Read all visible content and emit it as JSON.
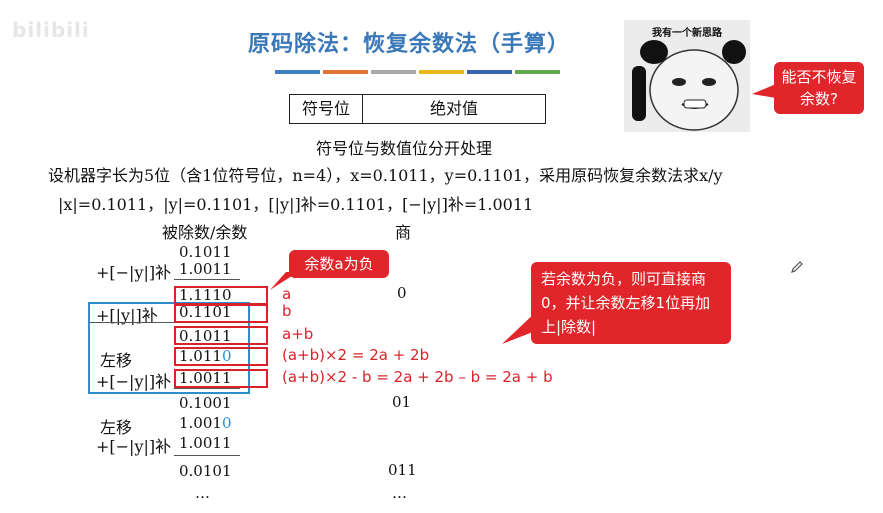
{
  "watermark": "bilibili",
  "title": "原码除法：恢复余数法（手算）",
  "color_bars": [
    "#3f7fc2",
    "#e0743a",
    "#a8a8a8",
    "#e7b81e",
    "#3a64a8",
    "#63a84a"
  ],
  "format_table": {
    "sign": "符号位",
    "magnitude": "绝对值"
  },
  "subtitle": "符号位与数值位分开处理",
  "problem_line": "设机器字长为5位（含1位符号位，n=4），x=0.1011，y=0.1101，采用原码恢复余数法求x/y",
  "values_line": "|x|=0.1011，|y|=0.1101，[|y|]补=0.1101，[−|y|]补=1.0011",
  "headers": {
    "dividend": "被除数/余数",
    "quotient": "商"
  },
  "rows": {
    "r1": "0.1011",
    "r2": "1.0011",
    "r3": "1.1110",
    "r4": "0.1101",
    "r5": "0.1011",
    "r6_main": "1.011",
    "r6_tail": "0",
    "r7": "1.0011",
    "r8": "0.1001",
    "r9_main": "1.001",
    "r9_tail": "0",
    "r10": "1.0011",
    "r11": "0.0101",
    "r12": "…"
  },
  "labels": {
    "add_neg_y": "+[−|y|]补",
    "add_y": "+[|y|]补",
    "shift_left": "左移"
  },
  "quotients": {
    "q1": "0",
    "q2": "01",
    "q3": "011",
    "q4": "…"
  },
  "annotations": {
    "a": "a",
    "b": "b",
    "a_plus_b": "a+b",
    "shift": "(a+b)×2 = 2a + 2b",
    "shift_minus": "(a+b)×2 - b = 2a + 2b – b = 2a + b"
  },
  "callout_negative": "余数a为负",
  "callout_explain": "若余数为负，则可直接商0，并让余数左移1位再加上|除数|",
  "meme": {
    "caption": "我有一个新思路",
    "bubble": "能否不恢复余数?"
  }
}
